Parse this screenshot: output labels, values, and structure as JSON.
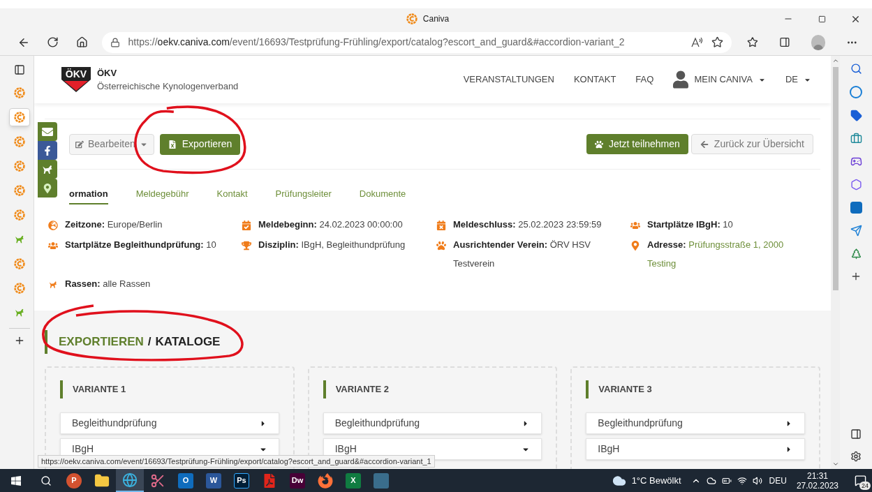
{
  "browser": {
    "tab_title": "Caniva",
    "url": {
      "scheme": "https://",
      "host": "oekv.caniva.com",
      "path": "/event/16693/Testprüfung-Frühling/export/catalog?escort_and_guard&#accordion-variant_2"
    }
  },
  "vertical_tabs": [
    {
      "kind": "caniva",
      "selected": false
    },
    {
      "kind": "caniva",
      "selected": true
    },
    {
      "kind": "caniva",
      "selected": false
    },
    {
      "kind": "caniva",
      "selected": false
    },
    {
      "kind": "caniva",
      "selected": false
    },
    {
      "kind": "caniva",
      "selected": false
    },
    {
      "kind": "dog",
      "selected": false
    },
    {
      "kind": "caniva",
      "selected": false
    },
    {
      "kind": "caniva",
      "selected": false
    },
    {
      "kind": "dog",
      "selected": false
    }
  ],
  "site": {
    "logo_text": "ÖKV",
    "name": "ÖKV",
    "subtitle": "Österreichische Kynologenverband"
  },
  "nav": [
    {
      "label": "VERANSTALTUNGEN",
      "kind": "link"
    },
    {
      "label": "KONTAKT",
      "kind": "link"
    },
    {
      "label": "FAQ",
      "kind": "link"
    },
    {
      "label": "MEIN CANIVA",
      "kind": "account"
    },
    {
      "label": "DE",
      "kind": "dropdown"
    }
  ],
  "social": [
    {
      "kind": "mail"
    },
    {
      "kind": "facebook"
    },
    {
      "kind": "dog"
    },
    {
      "kind": "location"
    }
  ],
  "actions": {
    "left": [
      {
        "label": "Bearbeiten",
        "kind": "edit"
      },
      {
        "label": "Exportieren",
        "kind": "export"
      }
    ],
    "right": [
      {
        "label": "Jetzt teilnehmen",
        "kind": "join"
      },
      {
        "label": "Zurück zur Übersicht",
        "kind": "back"
      }
    ]
  },
  "tabs": [
    {
      "label": "ormation",
      "selected": true
    },
    {
      "label": "Meldegebühr",
      "selected": false
    },
    {
      "label": "Kontakt",
      "selected": false
    },
    {
      "label": "Prüfungsleiter",
      "selected": false
    },
    {
      "label": "Dokumente",
      "selected": false
    }
  ],
  "info": [
    {
      "kind": "globe",
      "label": "Zeitzone:",
      "value": "Europe/Berlin",
      "link": false
    },
    {
      "kind": "calendar-check",
      "label": "Meldebeginn:",
      "value": "24.02.2023 00:00:00",
      "link": false
    },
    {
      "kind": "calendar-x",
      "label": "Meldeschluss:",
      "value": "25.02.2023 23:59:59",
      "link": false
    },
    {
      "kind": "users",
      "label": "Startplätze IBgH:",
      "value": "10",
      "link": false
    },
    {
      "kind": "users",
      "label": "Startplätze Begleithundprüfung:",
      "value": "10",
      "link": false
    },
    {
      "kind": "trophy",
      "label": "Disziplin:",
      "value": "IBgH, Begleithundprüfung",
      "link": false
    },
    {
      "kind": "paw",
      "label": "Ausrichtender Verein:",
      "value": "ÖRV HSV Testverein",
      "link": false
    },
    {
      "kind": "marker",
      "label": "Adresse:",
      "value": "Prüfungsstraße 1, 2000 Testing",
      "link": true
    },
    {
      "kind": "dog",
      "label": "Rassen:",
      "value": "alle Rassen",
      "link": false
    }
  ],
  "section_heading": {
    "parent": "EXPORTIEREN",
    "separator": "/",
    "title": "KATALOGE"
  },
  "variants": [
    {
      "title": "VARIANTE 1",
      "items": [
        {
          "label": "Begleithundprüfung",
          "expanded": false
        },
        {
          "label": "IBgH",
          "expanded": true
        }
      ]
    },
    {
      "title": "VARIANTE 2",
      "items": [
        {
          "label": "Begleithundprüfung",
          "expanded": false
        },
        {
          "label": "IBgH",
          "expanded": true
        }
      ]
    },
    {
      "title": "VARIANTE 3",
      "items": [
        {
          "label": "Begleithundprüfung",
          "expanded": false
        },
        {
          "label": "IBgH",
          "expanded": false
        }
      ]
    }
  ],
  "status_url": "https://oekv.caniva.com/event/16693/Testprüfung-Frühling/export/catalog?escort_and_guard&#accordion-variant_1",
  "taskbar": {
    "apps": [
      {
        "kind": "powerpoint",
        "glyph": "P",
        "selected": false
      },
      {
        "kind": "explorer",
        "selected": false
      },
      {
        "kind": "edge",
        "selected": true
      },
      {
        "kind": "snipping",
        "selected": false
      },
      {
        "kind": "outlook",
        "glyph": "O",
        "selected": false
      },
      {
        "kind": "word",
        "glyph": "W",
        "selected": false
      },
      {
        "kind": "photoshop",
        "glyph": "Ps",
        "selected": false
      },
      {
        "kind": "acrobat",
        "selected": false
      },
      {
        "kind": "dreamweaver",
        "glyph": "Dw",
        "selected": false
      },
      {
        "kind": "firefox",
        "selected": false
      },
      {
        "kind": "excel",
        "glyph": "X",
        "selected": false
      },
      {
        "kind": "game",
        "selected": false
      }
    ],
    "weather": "1°C Bewölkt",
    "language": "DEU",
    "time": "21:31",
    "date": "27.02.2023",
    "notifications": "24"
  }
}
